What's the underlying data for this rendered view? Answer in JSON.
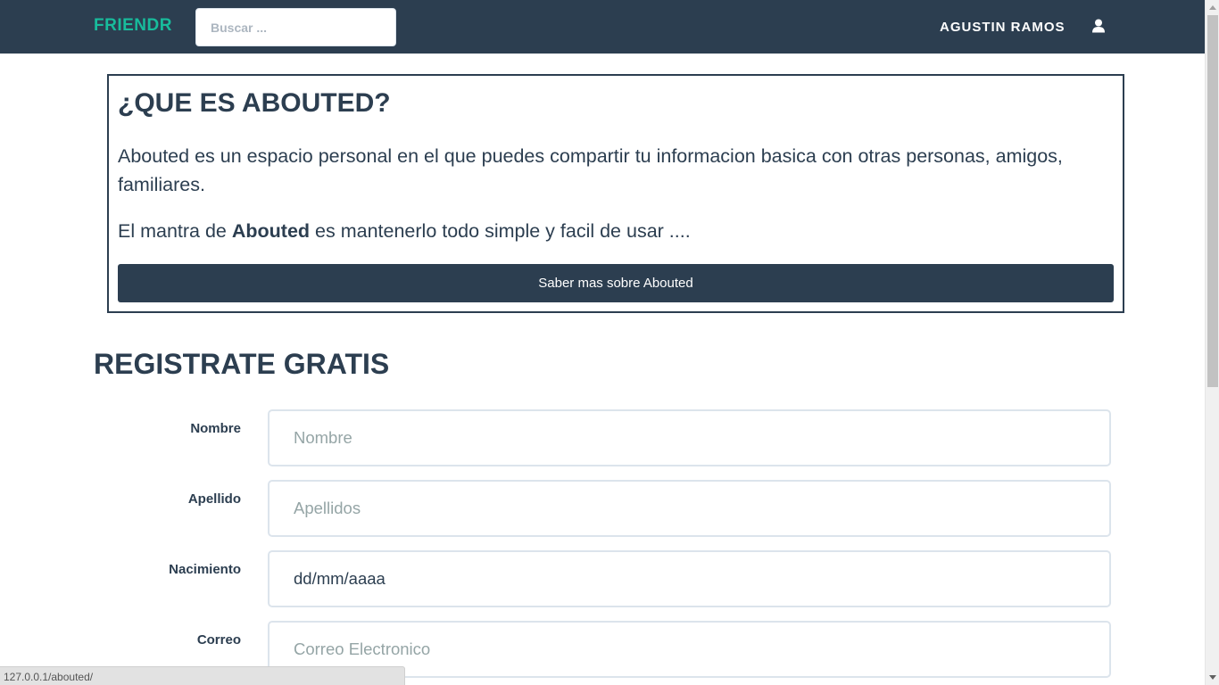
{
  "navbar": {
    "brand": "FRIENDR",
    "search_placeholder": "Buscar ...",
    "user_name": "AGUSTIN RAMOS",
    "user_icon": "user-icon"
  },
  "about": {
    "title": "¿QUE ES ABOUTED?",
    "paragraph1": "Abouted es un espacio personal en el que puedes compartir tu informacion basica con otras personas, amigos, familiares.",
    "paragraph2_before": "El mantra de ",
    "paragraph2_bold": "Abouted",
    "paragraph2_after": " es mantenerlo todo simple y facil de usar ....",
    "button_label": "Saber mas sobre Abouted"
  },
  "register": {
    "title": "REGISTRATE GRATIS",
    "fields": [
      {
        "label": "Nombre",
        "placeholder": "Nombre",
        "value": ""
      },
      {
        "label": "Apellido",
        "placeholder": "Apellidos",
        "value": ""
      },
      {
        "label": "Nacimiento",
        "placeholder": "",
        "value": "dd/mm/aaaa"
      },
      {
        "label": "Correo",
        "placeholder": "Correo Electronico",
        "value": ""
      }
    ]
  },
  "status_bar": {
    "url": "127.0.0.1/abouted/"
  },
  "colors": {
    "navbar_bg": "#2c3e50",
    "brand": "#18bc9c",
    "primary": "#2c3e50",
    "input_border": "#dce4ec"
  }
}
